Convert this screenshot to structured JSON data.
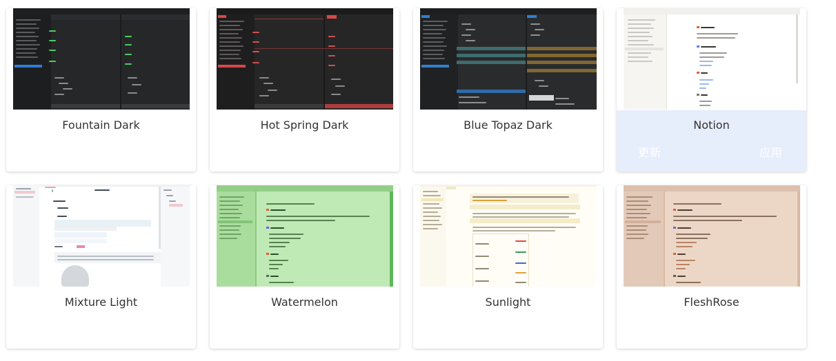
{
  "themes": [
    {
      "id": "fountain-dark",
      "name": "Fountain Dark",
      "colors": {
        "bg": "#262729",
        "side": "#1d1e20",
        "bar": "#1e1f21",
        "accent": "#2e7dd6",
        "text": "#4fcc63"
      }
    },
    {
      "id": "hot-spring-dark",
      "name": "Hot Spring Dark",
      "colors": {
        "bg": "#272627",
        "side": "#1f1e1f",
        "bar": "#1c1b1c",
        "accent": "#d84848",
        "text": "#d25050"
      }
    },
    {
      "id": "blue-topaz-dark",
      "name": "Blue Topaz Dark",
      "colors": {
        "bg": "#2a2b2c",
        "side": "#202122",
        "bar": "#1d1e1f",
        "accent": "#2f7fd1",
        "text": "#6fb0d8"
      }
    },
    {
      "id": "notion",
      "name": "Notion",
      "colors": {
        "bg": "#ffffff",
        "side": "#f6f5f2",
        "bar": "#f1f0ec",
        "accent": "#e6eefb",
        "text": "#37352f"
      }
    },
    {
      "id": "mixture-light",
      "name": "Mixture Light",
      "colors": {
        "bg": "#ffffff",
        "side": "#f5f6f8",
        "bar": "#eef0f3",
        "accent": "#3b8ac9",
        "text": "#444b55"
      }
    },
    {
      "id": "watermelon",
      "name": "Watermelon",
      "colors": {
        "bg": "#bfe9b5",
        "side": "#a9dd9e",
        "bar": "#93ce87",
        "accent": "#3a9a3a",
        "text": "#2a4c2a"
      }
    },
    {
      "id": "sunlight",
      "name": "Sunlight",
      "colors": {
        "bg": "#fffdf6",
        "side": "#fbf8ee",
        "bar": "#f6f2e4",
        "accent": "#e9b94b",
        "text": "#4e4a3a"
      }
    },
    {
      "id": "fleshrose",
      "name": "FleshRose",
      "colors": {
        "bg": "#ecd7c7",
        "side": "#e3cab8",
        "bar": "#dcc0ad",
        "accent": "#b98363",
        "text": "#4e3a30"
      }
    }
  ],
  "hovered_actions": {
    "update": "更新",
    "apply": "应用"
  }
}
